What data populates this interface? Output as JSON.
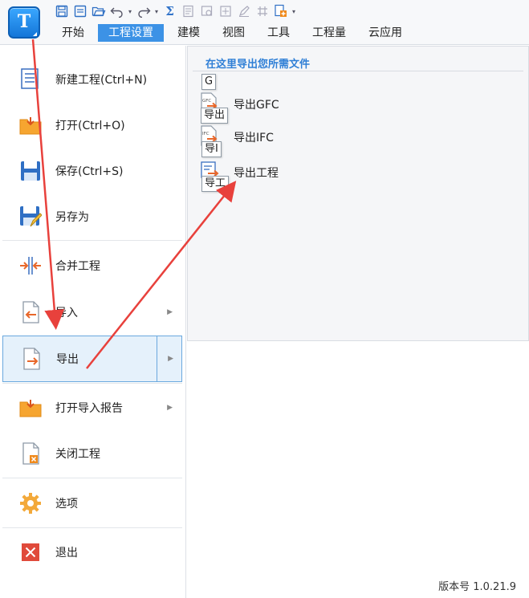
{
  "app": {
    "logo_letter": "T"
  },
  "quick_access": [
    {
      "icon": "save-icon"
    },
    {
      "icon": "save-all-icon"
    },
    {
      "icon": "open-folder-icon"
    },
    {
      "icon": "undo-icon"
    },
    {
      "icon": "redo-icon"
    },
    {
      "icon": "sum-icon",
      "glyph": "Σ"
    },
    {
      "icon": "report-icon"
    },
    {
      "icon": "query-icon"
    },
    {
      "icon": "view-icon"
    },
    {
      "icon": "edit-icon"
    },
    {
      "icon": "grid-icon"
    },
    {
      "icon": "add-file-icon"
    },
    {
      "icon": "customize-dropdown-icon"
    }
  ],
  "menu_tabs": [
    {
      "label": "开始"
    },
    {
      "label": "工程设置",
      "active": true
    },
    {
      "label": "建模"
    },
    {
      "label": "视图"
    },
    {
      "label": "工具"
    },
    {
      "label": "工程量"
    },
    {
      "label": "云应用"
    }
  ],
  "backstage": {
    "items": [
      {
        "label": "新建工程(Ctrl+N)",
        "icon": "new-project-icon"
      },
      {
        "label": "打开(Ctrl+O)",
        "icon": "open-icon"
      },
      {
        "label": "保存(Ctrl+S)",
        "icon": "save-icon"
      },
      {
        "label": "另存为",
        "icon": "save-as-icon"
      },
      {
        "label": "合并工程",
        "icon": "merge-icon"
      },
      {
        "label": "导入",
        "icon": "import-icon",
        "has_submenu": true
      },
      {
        "label": "导出",
        "icon": "export-icon",
        "has_submenu": true,
        "selected": true
      },
      {
        "label": "打开导入报告",
        "icon": "import-report-icon",
        "has_submenu": true
      },
      {
        "label": "关闭工程",
        "icon": "close-project-icon"
      },
      {
        "label": "选项",
        "icon": "options-gear-icon"
      },
      {
        "label": "退出",
        "icon": "exit-icon"
      }
    ]
  },
  "export_panel": {
    "heading": "在这里导出您所需文件",
    "entries": [
      {
        "label": "导出GFC",
        "icon_text": "GFC",
        "tooltip": "导出"
      },
      {
        "label": "导出IFC",
        "icon_text": "IFC",
        "tooltip": "导I"
      },
      {
        "label": "导出工程",
        "tooltip": "导工"
      }
    ],
    "top_tooltip": "G"
  },
  "footer": {
    "version": "版本号 1.0.21.9"
  },
  "colors": {
    "accent": "#3c92e6",
    "heading": "#2f7fd6",
    "selected_bg": "#e5f1fb",
    "annotation_arrow": "#e8413c"
  }
}
